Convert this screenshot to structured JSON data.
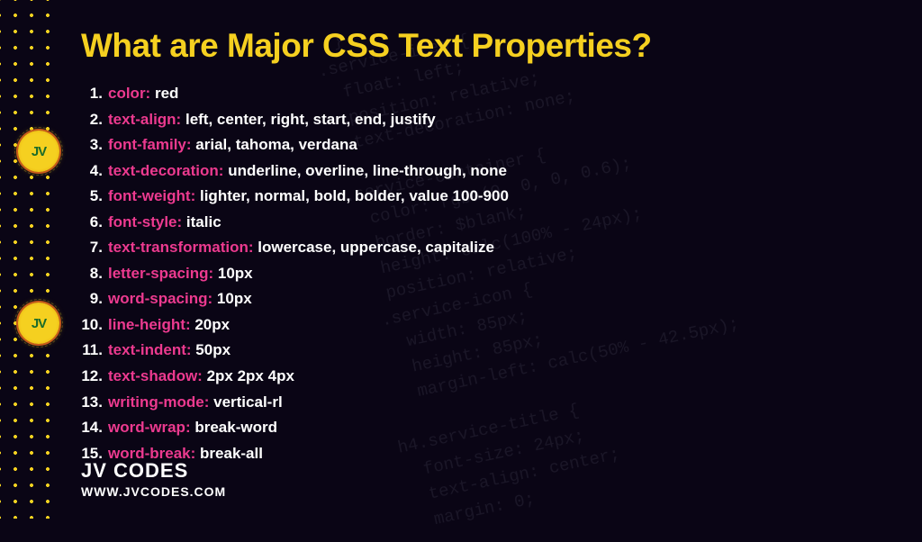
{
  "title": "What are Major CSS Text Properties?",
  "properties": [
    {
      "name": "color:",
      "value": "red"
    },
    {
      "name": "text-align:",
      "value": "left, center, right, start, end, justify"
    },
    {
      "name": "font-family:",
      "value": "arial, tahoma, verdana"
    },
    {
      "name": "text-decoration:",
      "value": "underline, overline, line-through, none"
    },
    {
      "name": "font-weight:",
      "value": "lighter, normal, bold, bolder, value 100-900"
    },
    {
      "name": "font-style:",
      "value": "italic"
    },
    {
      "name": "text-transformation:",
      "value": "lowercase, uppercase, capitalize"
    },
    {
      "name": "letter-spacing:",
      "value": "10px"
    },
    {
      "name": "word-spacing:",
      "value": "10px"
    },
    {
      "name": "line-height:",
      "value": "20px"
    },
    {
      "name": "text-indent:",
      "value": "50px"
    },
    {
      "name": "text-shadow:",
      "value": "2px 2px 4px"
    },
    {
      "name": "writing-mode:",
      "value": "vertical-rl"
    },
    {
      "name": "word-wrap:",
      "value": "break-word"
    },
    {
      "name": "word-break:",
      "value": "break-all"
    }
  ],
  "brand": "JV CODES",
  "url": "WWW.JVCODES.COM",
  "logo_text": "JV",
  "bg_code": "  }\n.service-item {\n  float: left;\n  position: relative;\n  text-decoration: none;\n\n.service-container {\n  color: rgba(0, 0, 0, 0.6);\n  border: $blank;\n  height: calc(100% - 24px);\n  position: relative;\n .service-icon {\n   width: 85px;\n   height: 85px;\n   margin-left: calc(50% - 42.5px);\n\nh4.service-title {\n  font-size: 24px;\n  text-align: center;\n  margin: 0;"
}
